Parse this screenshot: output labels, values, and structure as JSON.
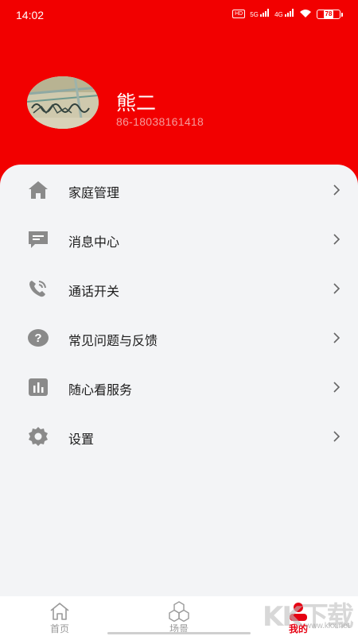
{
  "status_bar": {
    "time": "14:02",
    "hd_label": "HD",
    "net_5g": "5G",
    "net_4g": "4G",
    "battery": "78"
  },
  "profile": {
    "name": "熊二",
    "phone": "86-18038161418"
  },
  "menu": {
    "items": [
      {
        "label": "家庭管理",
        "icon": "home-icon"
      },
      {
        "label": "消息中心",
        "icon": "message-icon"
      },
      {
        "label": "通话开关",
        "icon": "phone-icon"
      },
      {
        "label": "常见问题与反馈",
        "icon": "question-icon"
      },
      {
        "label": "随心看服务",
        "icon": "chart-icon"
      },
      {
        "label": "设置",
        "icon": "gear-icon"
      }
    ]
  },
  "tabbar": {
    "tabs": [
      {
        "label": "首页",
        "icon": "home-icon",
        "active": false
      },
      {
        "label": "场景",
        "icon": "scene-icon",
        "active": false
      },
      {
        "label": "我的",
        "icon": "profile-icon",
        "active": true
      }
    ]
  },
  "watermark": {
    "big": "KK下载",
    "small": "www.kkx.net"
  },
  "colors": {
    "brand_red": "#f20000",
    "active_tab": "#e60012",
    "icon_gray": "#8a8a8a",
    "background": "#f3f4f6"
  }
}
